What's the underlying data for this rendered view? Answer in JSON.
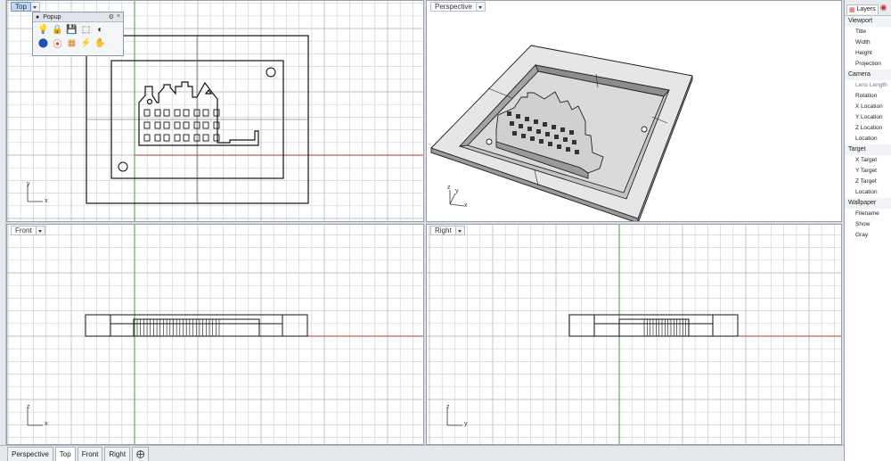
{
  "viewports": {
    "top": {
      "title": "Top",
      "axis_y": "y",
      "axis_x": "x"
    },
    "perspective": {
      "title": "Perspective",
      "axis_z": "z",
      "axis_y": "y",
      "axis_x": "x"
    },
    "front": {
      "title": "Front",
      "axis_z": "z",
      "axis_x": "x"
    },
    "right": {
      "title": "Right",
      "axis_z": "z",
      "axis_y": "y"
    }
  },
  "popup": {
    "title": "Popup",
    "icons_row1": [
      "lightbulb-icon",
      "lock-icon",
      "save-icon",
      "zoom-extents-icon",
      "sphere-shade-icon"
    ],
    "icons_row2": [
      "render-sphere-icon",
      "color-wheel-icon",
      "layers-stack-icon",
      "light-spot-icon",
      "pan-hand-icon"
    ]
  },
  "right_panel": {
    "tab_label": "Layers",
    "sections": [
      {
        "label": "Viewport",
        "items": [
          "Title",
          "Width",
          "Height",
          "Projection"
        ]
      },
      {
        "label": "Camera",
        "items": [
          "Lens Length",
          "Rotation",
          "X Location",
          "Y Location",
          "Z Location",
          "Location"
        ]
      },
      {
        "label": "Target",
        "items": [
          "X Target",
          "Y Target",
          "Z Target",
          "Location"
        ]
      },
      {
        "label": "Wallpaper",
        "items": [
          "Filename",
          "Show",
          "Gray"
        ]
      }
    ]
  },
  "bottom_tabs": [
    "Perspective",
    "Top",
    "Front",
    "Right"
  ],
  "active_tab": "Top",
  "colors": {
    "grid_minor": "#cfd3d8",
    "grid_major": "#a9aeb5",
    "x_axis": "#b23a3a",
    "y_axis": "#3aa04a",
    "model_gray": "#c9c9c9"
  }
}
